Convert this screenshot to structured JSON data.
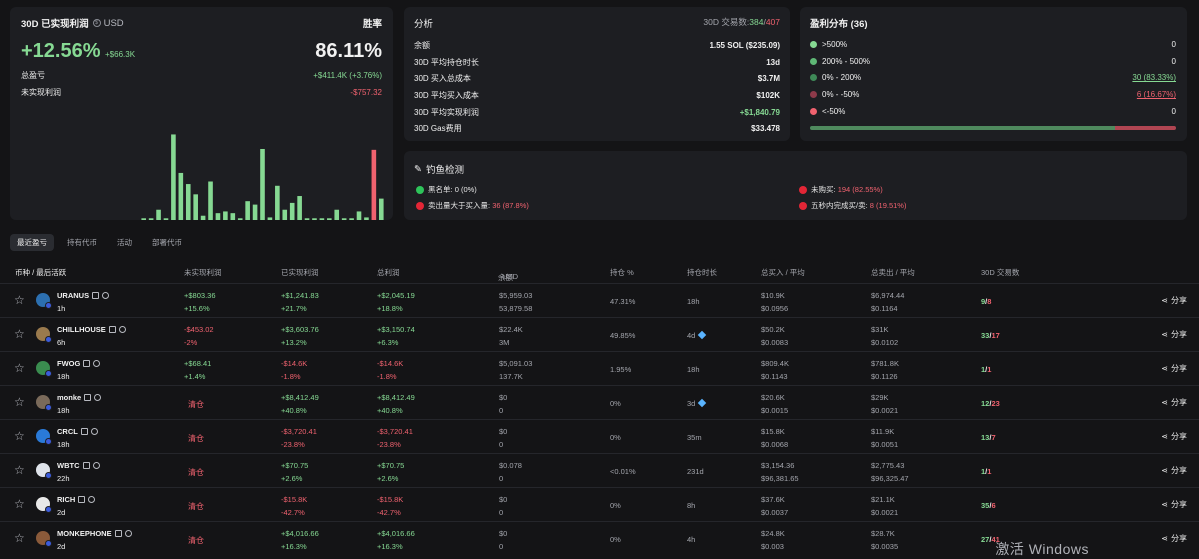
{
  "pnl": {
    "header_title": "30D 已实现利润",
    "currency": "USD",
    "winrate_label": "胜率",
    "pct": "+12.56%",
    "pct_usd": "+$66.3K",
    "winrate": "86.11%",
    "total_label": "总盈亏",
    "total_value": "+$411.4K (+3.76%)",
    "unrealized_label": "未实现利润",
    "unrealized_value": "-$757.32",
    "bars": [
      0.02,
      0.02,
      0.12,
      0.02,
      1.0,
      0.55,
      0.42,
      0.3,
      0.05,
      0.45,
      0.08,
      0.1,
      0.08,
      0.02,
      0.22,
      0.18,
      0.83,
      0.03,
      0.4,
      0.12,
      0.2,
      0.28,
      0.02,
      0.02,
      0.02,
      0.02,
      0.12,
      0.02,
      0.02,
      0.1,
      0.03,
      0.82,
      0.25
    ],
    "bar_red_index": 31
  },
  "analysis": {
    "title": "分析",
    "vol_label": "30D 交易数:",
    "vol_buy": "384",
    "vol_sep": "/",
    "vol_sell": "407",
    "rows": [
      {
        "label": "余额",
        "value": "1.55 SOL ($235.09)"
      },
      {
        "label": "30D 平均持仓时长",
        "value": "13d"
      },
      {
        "label": "30D 买入总成本",
        "value": "$3.7M"
      },
      {
        "label": "30D 平均买入成本",
        "value": "$102K"
      },
      {
        "label": "30D 平均实现利润",
        "value": "+$1,840.79"
      },
      {
        "label": "30D Gas费用",
        "value": "$33.478"
      }
    ]
  },
  "distribution": {
    "title": "盈利分布 (36)",
    "rows": [
      {
        "label": ">500%",
        "value": "0",
        "color": "#86d993"
      },
      {
        "label": "200% - 500%",
        "value": "0",
        "color": "#5fb876"
      },
      {
        "label": "0% - 200%",
        "value": "30 (83.33%)",
        "color": "#3f8a58"
      },
      {
        "label": "0% - -50%",
        "value": "6 (16.67%)",
        "color": "#8e3a4a"
      },
      {
        "label": "<-50%",
        "value": "0",
        "color": "#f0626f"
      }
    ],
    "bar_green_fraction": 0.8333
  },
  "phishing": {
    "title": "钓鱼检测",
    "blacklist_label": "黑名单:",
    "blacklist_value": "0 (0%)",
    "sell_gt_buy_label": "卖出量大于买入量:",
    "sell_gt_buy_value": "36 (87.8%)",
    "unbought_label": "未购买:",
    "unbought_value": "194 (82.55%)",
    "fast_label": "五秒内完成买/卖:",
    "fast_value": "8 (19.51%)"
  },
  "tabs": [
    "最近盈亏",
    "持有代币",
    "活动",
    "部署代币"
  ],
  "table_header": {
    "token": "币种 / 最后活跃",
    "unrealized": "未实现利润",
    "realized": "已实现利润",
    "total": "总利润",
    "balance": "余额",
    "balance_unit": "USD",
    "position": "持仓 %",
    "hold": "持仓时长",
    "bought": "总买入 / 平均",
    "sold": "总卖出 / 平均",
    "txs": "30D 交易数"
  },
  "rows": [
    {
      "name": "URANUS",
      "age": "1h",
      "avatar": "#2c6fb0",
      "unreal1": "+$803.36",
      "unreal2": "+15.6%",
      "cleared": "",
      "real1": "+$1,241.83",
      "real2": "+21.7%",
      "total1": "+$2,045.19",
      "total2": "+18.8%",
      "bal1": "$5,959.03",
      "bal2": "53,879.58",
      "pos": "47.31%",
      "hold": "18h",
      "diamond": false,
      "buy1": "$10.9K",
      "buy2": "$0.0956",
      "sell1": "$6,974.44",
      "sell2": "$0.1164",
      "tx_buy": "9",
      "tx_sell": "8"
    },
    {
      "name": "CHILLHOUSE",
      "age": "6h",
      "avatar": "#9a7a4d",
      "unreal1": "-$453.02",
      "unreal2": "-2%",
      "cleared": "",
      "real1": "+$3,603.76",
      "real2": "+13.2%",
      "total1": "+$3,150.74",
      "total2": "+6.3%",
      "bal1": "$22.4K",
      "bal2": "3M",
      "pos": "49.85%",
      "hold": "4d",
      "diamond": true,
      "buy1": "$50.2K",
      "buy2": "$0.0083",
      "sell1": "$31K",
      "sell2": "$0.0102",
      "tx_buy": "33",
      "tx_sell": "17"
    },
    {
      "name": "FWOG",
      "age": "18h",
      "avatar": "#3a8c4f",
      "unreal1": "+$68.41",
      "unreal2": "+1.4%",
      "cleared": "",
      "real1": "-$14.6K",
      "real2": "-1.8%",
      "total1": "-$14.6K",
      "total2": "-1.8%",
      "bal1": "$5,091.03",
      "bal2": "137.7K",
      "pos": "1.95%",
      "hold": "18h",
      "diamond": false,
      "buy1": "$809.4K",
      "buy2": "$0.1143",
      "sell1": "$781.8K",
      "sell2": "$0.1126",
      "tx_buy": "1",
      "tx_sell": "1"
    },
    {
      "name": "monke",
      "age": "18h",
      "avatar": "#7a6a5a",
      "unreal1": "",
      "unreal2": "",
      "cleared": "清仓",
      "real1": "+$8,412.49",
      "real2": "+40.8%",
      "total1": "+$8,412.49",
      "total2": "+40.8%",
      "bal1": "$0",
      "bal2": "0",
      "pos": "0%",
      "hold": "3d",
      "diamond": true,
      "buy1": "$20.6K",
      "buy2": "$0.0015",
      "sell1": "$29K",
      "sell2": "$0.0021",
      "tx_buy": "12",
      "tx_sell": "23"
    },
    {
      "name": "CRCL",
      "age": "18h",
      "avatar": "#2a7ad8",
      "unreal1": "",
      "unreal2": "",
      "cleared": "清仓",
      "real1": "-$3,720.41",
      "real2": "-23.8%",
      "total1": "-$3,720.41",
      "total2": "-23.8%",
      "bal1": "$0",
      "bal2": "0",
      "pos": "0%",
      "hold": "35m",
      "diamond": false,
      "buy1": "$15.8K",
      "buy2": "$0.0068",
      "sell1": "$11.9K",
      "sell2": "$0.0051",
      "tx_buy": "13",
      "tx_sell": "7"
    },
    {
      "name": "WBTC",
      "age": "22h",
      "avatar": "#dfe3ea",
      "unreal1": "",
      "unreal2": "",
      "cleared": "清仓",
      "real1": "+$70.75",
      "real2": "+2.6%",
      "total1": "+$70.75",
      "total2": "+2.6%",
      "bal1": "$0.078",
      "bal2": "0",
      "pos": "<0.01%",
      "hold": "231d",
      "diamond": false,
      "buy1": "$3,154.36",
      "buy2": "$96,381.65",
      "sell1": "$2,775.43",
      "sell2": "$96,325.47",
      "tx_buy": "1",
      "tx_sell": "1"
    },
    {
      "name": "RICH",
      "age": "2d",
      "avatar": "#e8e8e8",
      "unreal1": "",
      "unreal2": "",
      "cleared": "清仓",
      "real1": "-$15.8K",
      "real2": "-42.7%",
      "total1": "-$15.8K",
      "total2": "-42.7%",
      "bal1": "$0",
      "bal2": "0",
      "pos": "0%",
      "hold": "8h",
      "diamond": false,
      "buy1": "$37.6K",
      "buy2": "$0.0037",
      "sell1": "$21.1K",
      "sell2": "$0.0021",
      "tx_buy": "35",
      "tx_sell": "6"
    },
    {
      "name": "MONKEPHONE",
      "age": "2d",
      "avatar": "#8a5a3a",
      "unreal1": "",
      "unreal2": "",
      "cleared": "清仓",
      "real1": "+$4,016.66",
      "real2": "+16.3%",
      "total1": "+$4,016.66",
      "total2": "+16.3%",
      "bal1": "$0",
      "bal2": "0",
      "pos": "0%",
      "hold": "4h",
      "diamond": false,
      "buy1": "$24.8K",
      "buy2": "$0.003",
      "sell1": "$28.7K",
      "sell2": "$0.0035",
      "tx_buy": "27",
      "tx_sell": "41"
    }
  ],
  "share_label": "分享",
  "watermark": "激活 Windows",
  "colors": {
    "green": "#86d993",
    "red": "#f0626f",
    "bg": "#141416",
    "card": "#1d1e22"
  }
}
